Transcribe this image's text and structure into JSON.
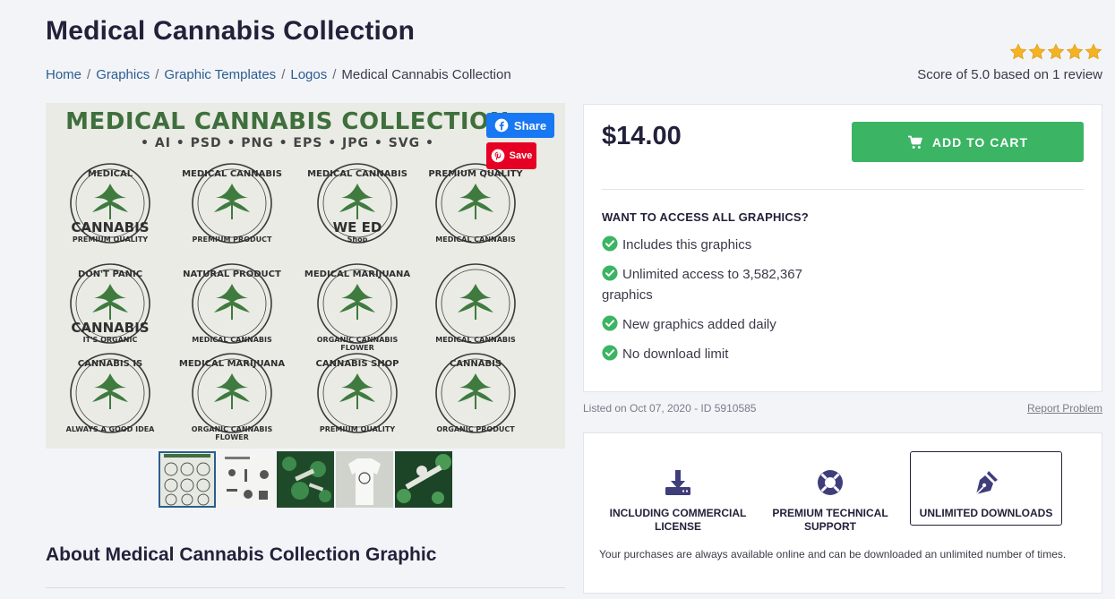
{
  "page": {
    "title": "Medical Cannabis Collection"
  },
  "breadcrumb": {
    "items": [
      "Home",
      "Graphics",
      "Graphic Templates",
      "Logos"
    ],
    "current": "Medical Cannabis Collection",
    "separator": "/"
  },
  "rating": {
    "stars": 5,
    "score_text": "Score of 5.0 based on 1 review",
    "star_color": "#f5b323"
  },
  "preview": {
    "heading": "MEDICAL CANNABIS COLLECTION",
    "formats": "• AI • PSD • PNG • EPS • JPG • SVG •",
    "badges": [
      {
        "top": "MEDICAL",
        "mid": "CANNABIS",
        "bottom": "PREMIUM QUALITY"
      },
      {
        "top": "MEDICAL CANNABIS",
        "mid": "",
        "bottom": "PREMIUM PRODUCT"
      },
      {
        "top": "MEDICAL CANNABIS",
        "mid": "WE   ED",
        "bottom": "Shop"
      },
      {
        "top": "PREMIUM QUALITY",
        "mid": "",
        "bottom": "MEDICAL CANNABIS"
      },
      {
        "top": "DON'T PANIC",
        "mid": "CANNABIS",
        "bottom": "IT'S ORGANIC"
      },
      {
        "top": "NATURAL PRODUCT",
        "mid": "",
        "bottom": "MEDICAL CANNABIS"
      },
      {
        "top": "MEDICAL MARIJUANA",
        "mid": "",
        "bottom": "ORGANIC CANNABIS FLOWER"
      },
      {
        "top": "",
        "mid": "",
        "bottom": "MEDICAL CANNABIS"
      },
      {
        "top": "CANNABIS IS",
        "mid": "",
        "bottom": "ALWAYS A GOOD IDEA"
      },
      {
        "top": "MEDICAL MARIJUANA",
        "mid": "",
        "bottom": "ORGANIC CANNABIS FLOWER"
      },
      {
        "top": "CANNABIS SHOP",
        "mid": "",
        "bottom": "PREMIUM QUALITY"
      },
      {
        "top": "CANNABIS",
        "mid": "",
        "bottom": "ORGANIC PRODUCT"
      }
    ],
    "share_label": "Share",
    "save_label": "Save"
  },
  "purchase": {
    "price": "$14.00",
    "add_to_cart": "ADD TO CART",
    "access_heading": "WANT TO ACCESS ALL GRAPHICS?",
    "features": [
      "Includes this graphics",
      "Unlimited access to 3,582,367 graphics",
      "New graphics added daily",
      "No download limit"
    ],
    "accent_color": "#3bb463"
  },
  "meta": {
    "listed": "Listed on Oct 07, 2020 - ID 5910585",
    "report": "Report Problem"
  },
  "perks": {
    "items": [
      {
        "label": "INCLUDING COMMERCIAL LICENSE",
        "icon": "download-icon"
      },
      {
        "label": "PREMIUM TECHNICAL SUPPORT",
        "icon": "lifebuoy-icon"
      },
      {
        "label": "UNLIMITED DOWNLOADS",
        "icon": "pen-nib-icon"
      }
    ],
    "note": "Your purchases are always available online and can be downloaded an unlimited number of times."
  },
  "about": {
    "heading": "About Medical Cannabis Collection Graphic"
  }
}
